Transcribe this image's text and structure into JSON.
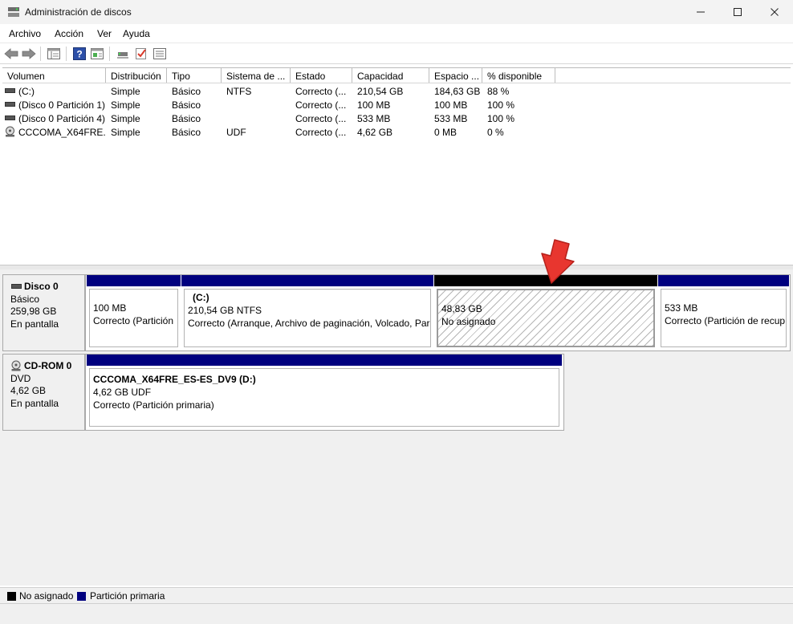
{
  "window": {
    "title": "Administración de discos",
    "minimize_icon": "minimize-icon",
    "maximize_icon": "maximize-icon",
    "close_icon": "close-icon"
  },
  "menu": {
    "items": [
      "Archivo",
      "Acción",
      "Ver",
      "Ayuda"
    ]
  },
  "toolbar": {
    "buttons": [
      "back-icon",
      "forward-icon",
      "console-tree-icon",
      "help-icon",
      "action-pane-icon",
      "connect-icon",
      "checkmark-icon",
      "properties-icon"
    ]
  },
  "volume_list": {
    "columns": [
      "Volumen",
      "Distribución",
      "Tipo",
      "Sistema de ...",
      "Estado",
      "Capacidad",
      "Espacio ...",
      "% disponible"
    ],
    "rows": [
      {
        "volume": "(C:)",
        "layout": "Simple",
        "type": "Básico",
        "fs": "NTFS",
        "status": "Correcto (...",
        "capacity": "210,54 GB",
        "free": "184,63 GB",
        "pct": "88 %",
        "icon": "drive-icon"
      },
      {
        "volume": "(Disco 0 Partición 1)",
        "layout": "Simple",
        "type": "Básico",
        "fs": "",
        "status": "Correcto (...",
        "capacity": "100 MB",
        "free": "100 MB",
        "pct": "100 %",
        "icon": "drive-icon"
      },
      {
        "volume": "(Disco 0 Partición 4)",
        "layout": "Simple",
        "type": "Básico",
        "fs": "",
        "status": "Correcto (...",
        "capacity": "533 MB",
        "free": "533 MB",
        "pct": "100 %",
        "icon": "drive-icon"
      },
      {
        "volume": "CCCOMA_X64FRE...",
        "layout": "Simple",
        "type": "Básico",
        "fs": "UDF",
        "status": "Correcto (...",
        "capacity": "4,62 GB",
        "free": "0 MB",
        "pct": "0 %",
        "icon": "cd-icon"
      }
    ]
  },
  "disks": [
    {
      "name": "Disco 0",
      "kind": "Básico",
      "size": "259,98 GB",
      "state": "En pantalla",
      "partitions": [
        {
          "line1": "",
          "line2": "100 MB",
          "line3": "Correcto (Partición",
          "style": "primary"
        },
        {
          "line1": "(C:)",
          "line2": "210,54 GB NTFS",
          "line3": "Correcto (Arranque, Archivo de paginación, Volcado, Par",
          "style": "primary"
        },
        {
          "line1": "",
          "line2": "48,83 GB",
          "line3": "No asignado",
          "style": "unalloc"
        },
        {
          "line1": "",
          "line2": "533 MB",
          "line3": "Correcto (Partición de recup",
          "style": "primary"
        }
      ]
    },
    {
      "name": "CD-ROM 0",
      "kind": "DVD",
      "size": "4,62 GB",
      "state": "En pantalla",
      "partitions": [
        {
          "line1": "CCCOMA_X64FRE_ES-ES_DV9  (D:)",
          "line2": "4,62 GB UDF",
          "line3": "Correcto (Partición primaria)",
          "style": "primary"
        }
      ]
    }
  ],
  "legend": {
    "items": [
      {
        "label": "No asignado",
        "color": "#000000"
      },
      {
        "label": "Partición primaria",
        "color": "#00007f"
      }
    ]
  },
  "colors": {
    "primary_partition": "#00007f",
    "unallocated": "#000000",
    "annotation_arrow": "#e8362f"
  }
}
